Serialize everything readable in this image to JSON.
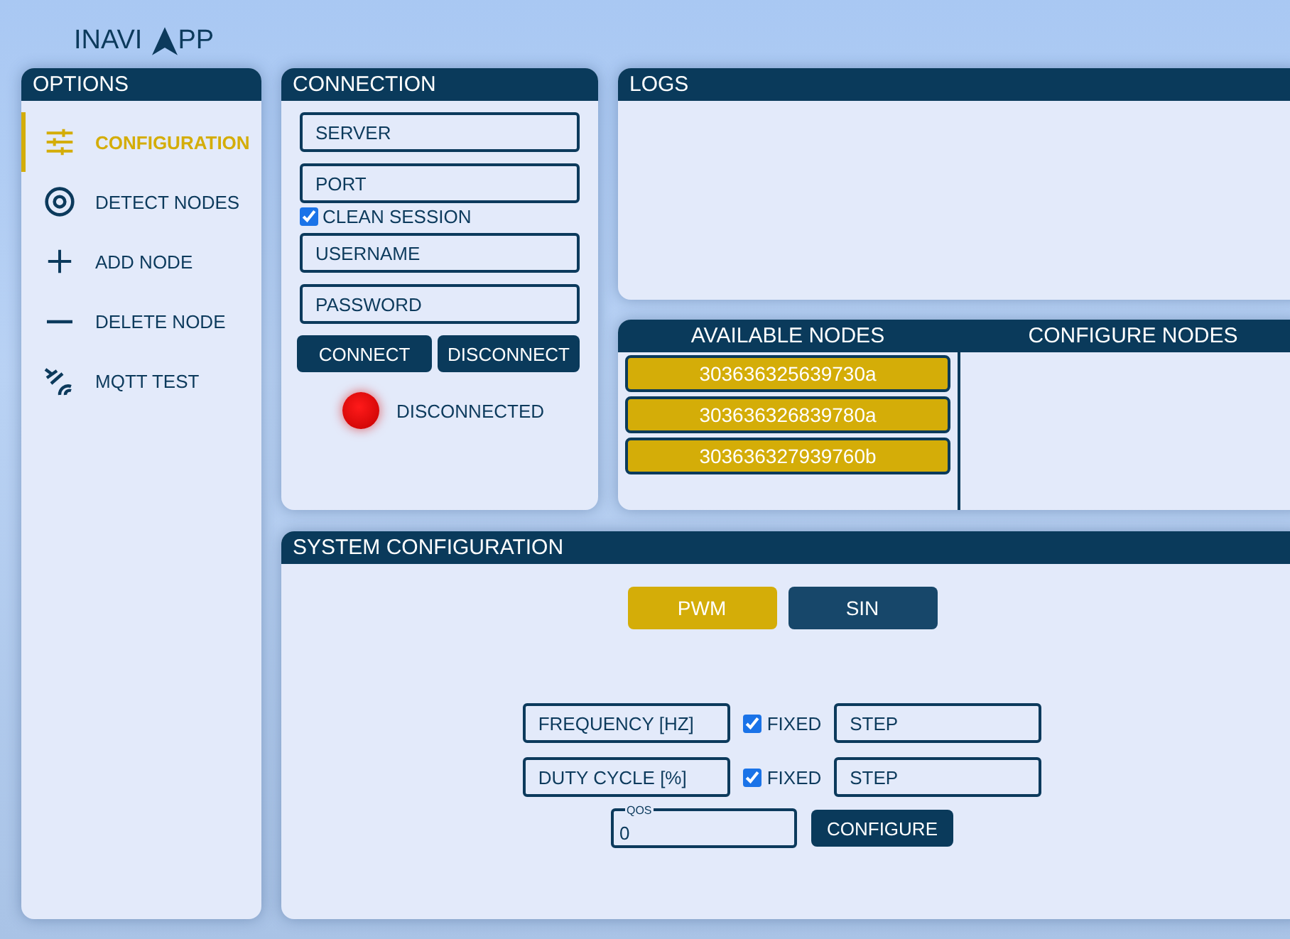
{
  "app_title": {
    "prefix": "INAVI",
    "suffix": "PP"
  },
  "sidebar": {
    "title": "OPTIONS",
    "items": [
      {
        "label": "CONFIGURATION",
        "selected": true
      },
      {
        "label": "DETECT NODES",
        "selected": false
      },
      {
        "label": "ADD NODE",
        "selected": false
      },
      {
        "label": "DELETE NODE",
        "selected": false
      },
      {
        "label": "MQTT TEST",
        "selected": false
      }
    ]
  },
  "connection": {
    "title": "CONNECTION",
    "fields": [
      {
        "placeholder": "SERVER"
      },
      {
        "placeholder": "PORT"
      }
    ],
    "clean_session": {
      "label": "CLEAN SESSION",
      "checked": true
    },
    "credentials": [
      {
        "placeholder": "USERNAME"
      },
      {
        "placeholder": "PASSWORD"
      }
    ],
    "buttons": [
      "CONNECT",
      "DISCONNECT"
    ],
    "status": {
      "connected": false,
      "label": "DISCONNECTED"
    }
  },
  "logs": {
    "title": "LOGS"
  },
  "available_nodes": {
    "title": "AVAILABLE NODES",
    "items": [
      "303636325639730a",
      "303636326839780a",
      "303636327939760b"
    ]
  },
  "configure_nodes": {
    "title": "CONFIGURE NODES"
  },
  "system_configuration": {
    "title": "SYSTEM CONFIGURATION",
    "modes": [
      {
        "label": "PWM",
        "selected": true
      },
      {
        "label": "SIN",
        "selected": false
      }
    ],
    "rows": [
      {
        "placeholder": "FREQUENCY [HZ]",
        "fixed": {
          "label": "FIXED",
          "checked": true
        },
        "step_placeholder": "STEP"
      },
      {
        "placeholder": "DUTY CYCLE [%]",
        "fixed": {
          "label": "FIXED",
          "checked": true
        },
        "step_placeholder": "STEP"
      }
    ],
    "qos": {
      "label": "QOS",
      "value": "0"
    },
    "configure_button": "CONFIGURE"
  }
}
